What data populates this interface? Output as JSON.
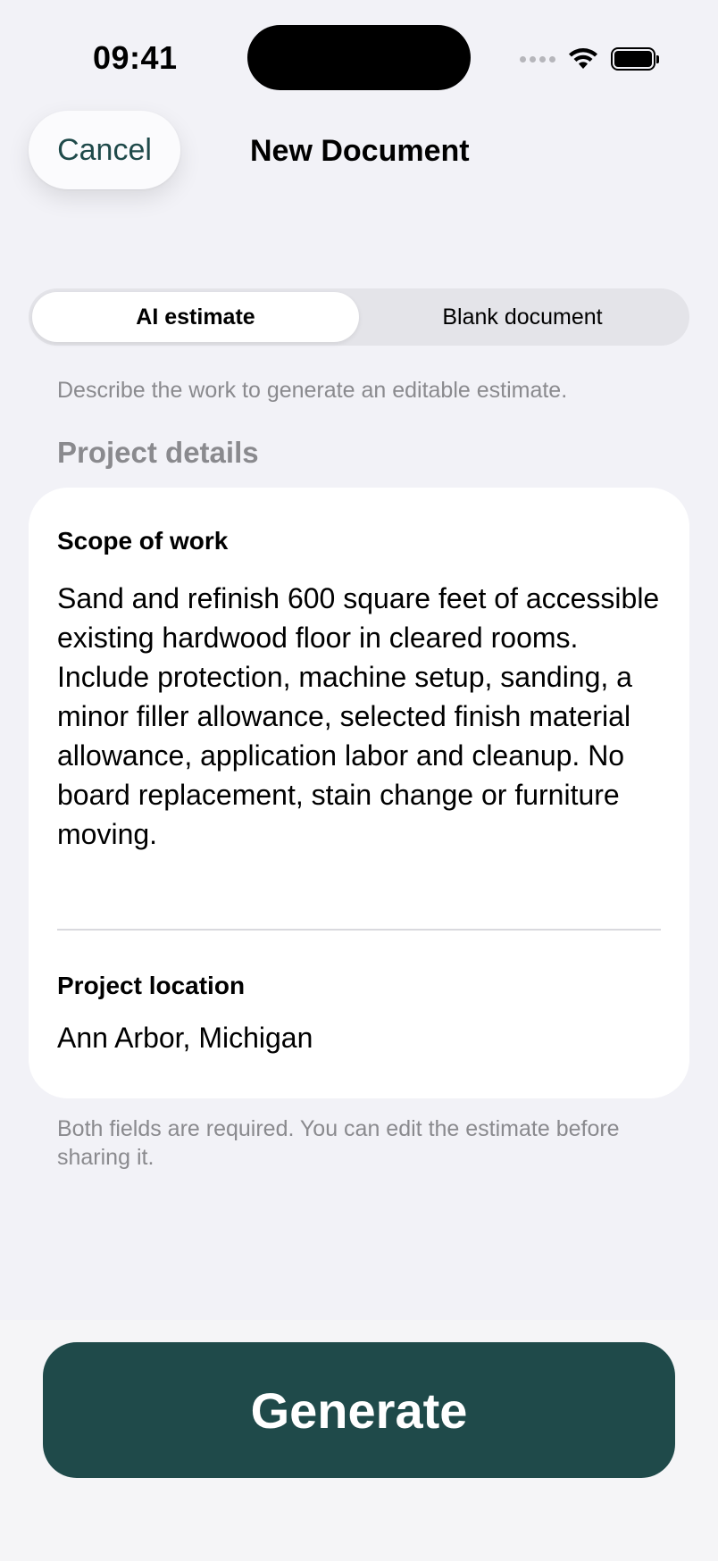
{
  "status_bar": {
    "time": "09:41"
  },
  "nav": {
    "cancel_label": "Cancel",
    "title": "New Document"
  },
  "mode_toggle": {
    "options": [
      "AI estimate",
      "Blank document"
    ],
    "selected": "AI estimate"
  },
  "helper_text": "Describe the work to generate an editable estimate.",
  "section_title": "Project details",
  "form": {
    "scope": {
      "label": "Scope of work",
      "value": "Sand and refinish 600 square feet of accessible existing hardwood floor in cleared rooms. Include protection, machine setup, sanding, a minor filler allowance, selected finish material allowance, application labor and cleanup. No board replacement, stain change or furniture moving."
    },
    "location": {
      "label": "Project location",
      "value": "Ann Arbor, Michigan"
    }
  },
  "footnote": "Both fields are required. You can edit the estimate before sharing it.",
  "primary_action": {
    "label": "Generate"
  },
  "colors": {
    "accent": "#1f4a4a",
    "background": "#f2f2f7",
    "secondary_text": "#8a8a8e"
  },
  "icons": [
    "cellular-signal-icon",
    "wifi-icon",
    "battery-icon"
  ]
}
